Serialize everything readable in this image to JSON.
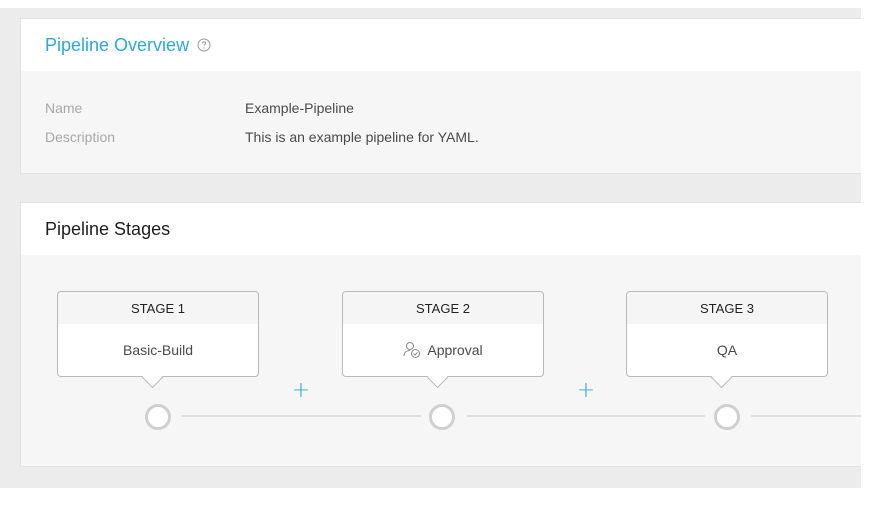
{
  "overview": {
    "title": "Pipeline Overview",
    "fields": [
      {
        "label": "Name",
        "value": "Example-Pipeline"
      },
      {
        "label": "Description",
        "value": "This is an example pipeline for YAML."
      }
    ]
  },
  "stages_section": {
    "title": "Pipeline Stages",
    "stages": [
      {
        "header": "STAGE 1",
        "name": "Basic-Build",
        "icon": ""
      },
      {
        "header": "STAGE 2",
        "name": "Approval",
        "icon": "approval-user-icon"
      },
      {
        "header": "STAGE 3",
        "name": "QA",
        "icon": ""
      }
    ],
    "add_symbol": "+"
  },
  "colors": {
    "accent": "#2fa8d4",
    "node_border": "#cfcfcf",
    "stage_border": "#b9b9b9"
  }
}
